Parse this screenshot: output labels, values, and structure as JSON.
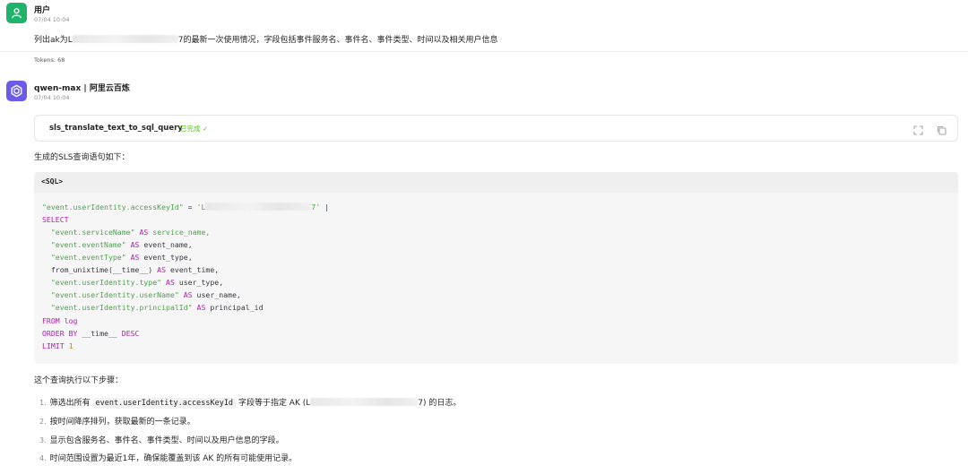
{
  "user_message": {
    "author": "用户",
    "time": "07/04 10:04",
    "text_prefix": "列出ak为L",
    "text_suffix": "7的最新一次使用情况，字段包括事件服务名、事件名、事件类型、时间以及相关用户信息",
    "tokens": "Tokens: 68"
  },
  "bot_message": {
    "author": "qwen-max | 阿里云百炼",
    "time": "07/04 10:04",
    "tool_call": {
      "name": "sls_translate_text_to_sql_query",
      "status": "已完成 ✓",
      "expand_icon": "expand-icon",
      "copy_icon": "copy-icon"
    },
    "intro": "生成的SLS查询语句如下：",
    "code_label": "<SQL>",
    "code": {
      "l1_str": "\"event.userIdentity.accessKeyId\"",
      "l1_op": " = ",
      "l1_val_prefix": "'L",
      "l1_val_suffix": "7'",
      "l1_pipe": " |",
      "l2": "SELECT",
      "l3_str": "\"event.serviceName\"",
      "l3_as": "AS",
      "l3_alias": "service_name,",
      "l4_str": "\"event.eventName\"",
      "l4_as": "AS",
      "l4_alias": "event_name,",
      "l5_str": "\"event.eventType\"",
      "l5_as": "AS",
      "l5_alias": "event_type,",
      "l6_fn": "from_unixtime(__time__)",
      "l6_as": "AS",
      "l6_alias": "event_time,",
      "l7_str": "\"event.userIdentity.type\"",
      "l7_as": "AS",
      "l7_alias": "user_type,",
      "l8_str": "\"event.userIdentity.userName\"",
      "l8_as": "AS",
      "l8_alias": "user_name,",
      "l9_str": "\"event.userIdentity.principalId\"",
      "l9_as": "AS",
      "l9_alias": "principal_id",
      "l10_kw": "FROM",
      "l10_tbl": "log",
      "l11_kw": "ORDER BY",
      "l11_col": "__time__",
      "l11_dir": "DESC",
      "l12_kw": "LIMIT",
      "l12_num": "1"
    },
    "steps_intro": "这个查询执行以下步骤：",
    "steps": [
      {
        "num": "1.",
        "pre": "筛选出所有",
        "code": "event.userIdentity.accessKeyId",
        "mid": "字段等于指定 AK (L",
        "post": "7) 的日志。"
      },
      {
        "num": "2.",
        "text": "按时间降序排列，获取最新的一条记录。"
      },
      {
        "num": "3.",
        "text": "显示包含服务名、事件名、事件类型、时间以及用户信息的字段。"
      },
      {
        "num": "4.",
        "text": "时间范围设置为最近1年，确保能覆盖到该 AK 的所有可能使用记录。"
      }
    ]
  }
}
